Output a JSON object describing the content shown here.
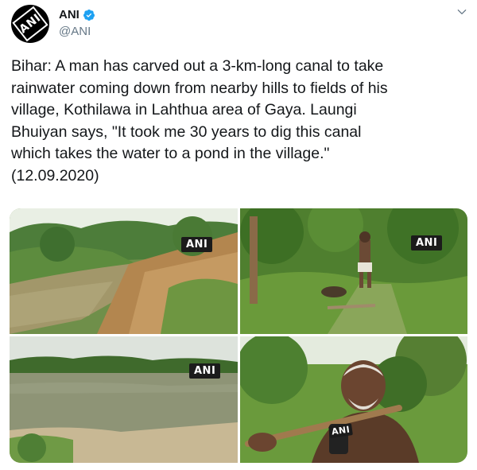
{
  "account": {
    "display_name": "ANI",
    "handle": "@ANI",
    "avatar_text": "ANI",
    "verified": true
  },
  "tweet": {
    "text": "Bihar: A man has carved out a 3-km-long canal to take\nrainwater coming down from nearby hills to fields of his\nvillage, Kothilawa in Lahthua area of Gaya. Laungi\nBhuiyan says, \"It took me 30 years to dig this canal\nwhich takes the water to a pond in the village.\"\n(12.09.2020)"
  },
  "media": {
    "watermarks": [
      "ANI",
      "ANI",
      "ANI"
    ],
    "mic_label": "ANI"
  },
  "colors": {
    "verified_blue": "#1da1f2",
    "secondary_text": "#657786"
  },
  "icons": {
    "verified": "verified-badge-icon",
    "menu": "chevron-down-icon"
  }
}
